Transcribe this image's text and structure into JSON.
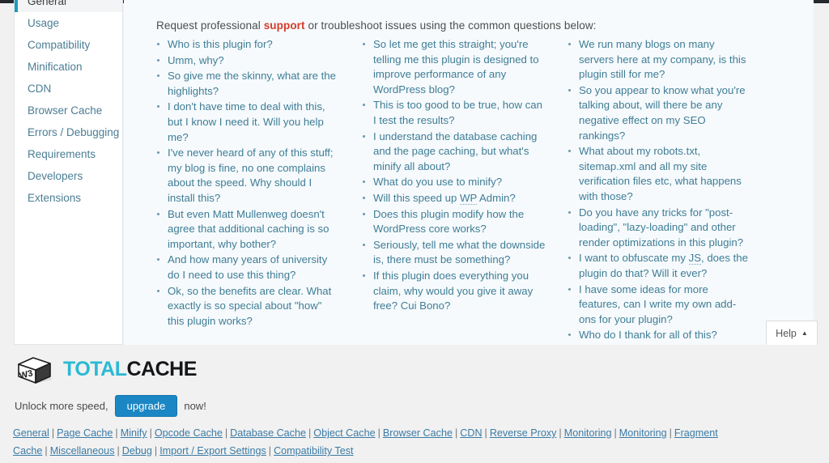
{
  "sidebar": {
    "items": [
      {
        "label": "General",
        "active": true
      },
      {
        "label": "Usage",
        "active": false
      },
      {
        "label": "Compatibility",
        "active": false
      },
      {
        "label": "Minification",
        "active": false
      },
      {
        "label": "CDN",
        "active": false
      },
      {
        "label": "Browser Cache",
        "active": false
      },
      {
        "label": "Errors / Debugging",
        "active": false
      },
      {
        "label": "Requirements",
        "active": false
      },
      {
        "label": "Developers",
        "active": false
      },
      {
        "label": "Extensions",
        "active": false
      }
    ]
  },
  "content": {
    "intro_before": "Request professional ",
    "intro_link": "support",
    "intro_after": " or troubleshoot issues using the common questions below:",
    "columns": [
      [
        "Who is this plugin for?",
        "Umm, why?",
        "So give me the skinny, what are the highlights?",
        "I don't have time to deal with this, but I know I need it. Will you help me?",
        "I've never heard of any of this stuff; my blog is fine, no one complains about the speed. Why should I install this?",
        "But even Matt Mullenweg doesn't agree that additional caching is so important, why bother?",
        "And how many years of university do I need to use this thing?",
        "Ok, so the benefits are clear. What exactly is so special about \"how\" this plugin works?"
      ],
      [
        "So let me get this straight; you're telling me this plugin is designed to improve performance of any WordPress blog?",
        "This is too good to be true, how can I test the results?",
        "I understand the database caching and the page caching, but what's minify all about?",
        "What do you use to minify?",
        "Will this speed up WP Admin?",
        "Does this plugin modify how the WordPress core works?",
        "Seriously, tell me what the downside is, there must be something?",
        "If this plugin does everything you claim, why would you give it away free? Cui Bono?"
      ],
      [
        "We run many blogs on many servers here at my company, is this plugin still for me?",
        "So you appear to know what you're talking about, will there be any negative effect on my SEO rankings?",
        "What about my robots.txt, sitemap.xml and all my site verification files etc, what happens with those?",
        "Do you have any tricks for \"post-loading\", \"lazy-loading\" and other render optimizations in this plugin?",
        "I want to obfuscate my JS, does the plugin do that? Will it ever?",
        "I have some ideas for more features, can I write my own add-ons for your plugin?",
        "Who do I thank for all of this?"
      ]
    ],
    "abbreviations": [
      "WP",
      "JS"
    ]
  },
  "help": {
    "label": "Help",
    "caret": "▲"
  },
  "footer": {
    "logo": {
      "cube_text": "W3",
      "word_one": "TOTAL",
      "word_two": "CACHE"
    },
    "upgrade": {
      "prefix": "Unlock more speed,",
      "button_label": "upgrade",
      "suffix": "now!"
    },
    "links": [
      "General",
      "Page Cache",
      "Minify",
      "Opcode Cache",
      "Database Cache",
      "Object Cache",
      "Browser Cache",
      "CDN",
      "Reverse Proxy",
      "Monitoring",
      "Monitoring",
      "Fragment Cache",
      "Miscellaneous",
      "Debug",
      "Import / Export Settings",
      "Compatibility Test"
    ],
    "separator": "|"
  },
  "colors": {
    "accent_teal": "#1d9bbf",
    "logo_cyan": "#2bb9d4",
    "support_red": "#d33c2a",
    "upgrade_blue": "#1b86c4",
    "panel_bg": "#f6fafd",
    "page_bg": "#f1f1f1"
  }
}
